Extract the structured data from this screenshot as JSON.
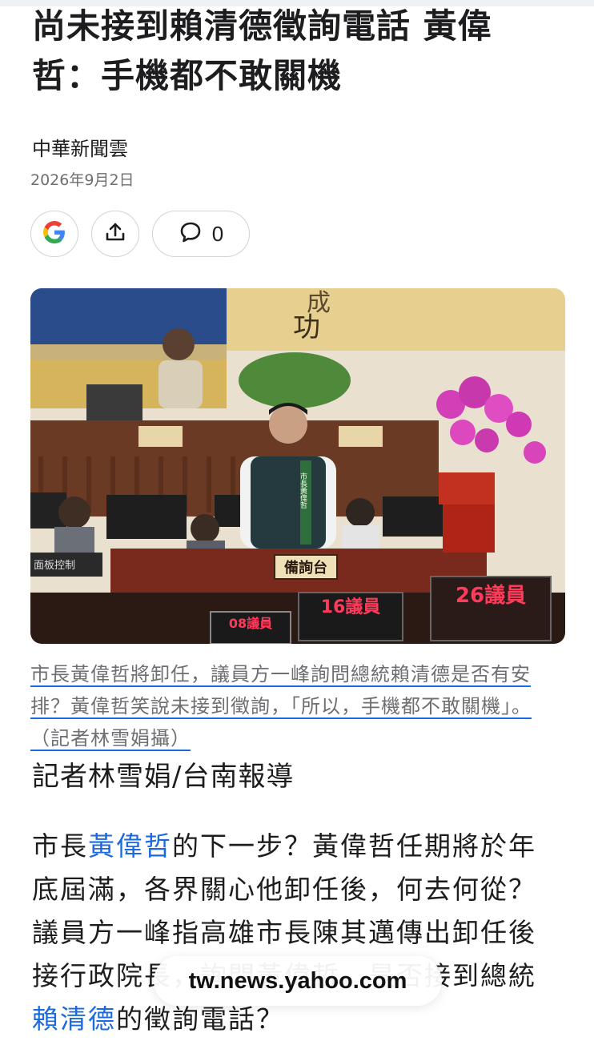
{
  "article": {
    "headline_line1": "尚未接到賴清德徵詢電話 黃偉",
    "headline_line2": "哲：手機都不敢關機",
    "source": "中華新聞雲",
    "date": "2026年9月2日"
  },
  "actions": {
    "google_icon": "google-icon",
    "share_icon": "share-icon",
    "comment_icon": "comment-icon",
    "comment_count": "0"
  },
  "photo": {
    "banner_char_top": "成",
    "banner_char_bottom": "功",
    "podium_sign": "備詢台",
    "sash_text": "市長黃偉哲",
    "sign_left": "08議員",
    "sign_mid": "16議員",
    "sign_right": "26議員",
    "side_label": "面板控制"
  },
  "caption": "市長黃偉哲將卸任，議員方一峰詢問總統賴清德是否有安排？黃偉哲笑說未接到徵詢，「所以，手機都不敢關機」。（記者林雪娟攝）",
  "byline": "記者林雪娟/台南報導",
  "body": {
    "p1_pre": "市長",
    "p1_link1": "黃偉哲",
    "p1_mid": "的下一步？黃偉哲任期將於年底屆滿，各界關心他卸任後，何去何從？議員方一峰指高雄市長陳其邁傳出卸任後接",
    "p1_hidden": "行政院長",
    "p1_mid2": "，詢問黃偉哲，是否接到總統",
    "p1_link2": "賴清德",
    "p1_post": "的徵詢電話？"
  },
  "browser": {
    "url": "tw.news.yahoo.com"
  },
  "colors": {
    "link": "#1a6ae0",
    "muted": "#6e6e73",
    "text": "#1d1d1f"
  }
}
